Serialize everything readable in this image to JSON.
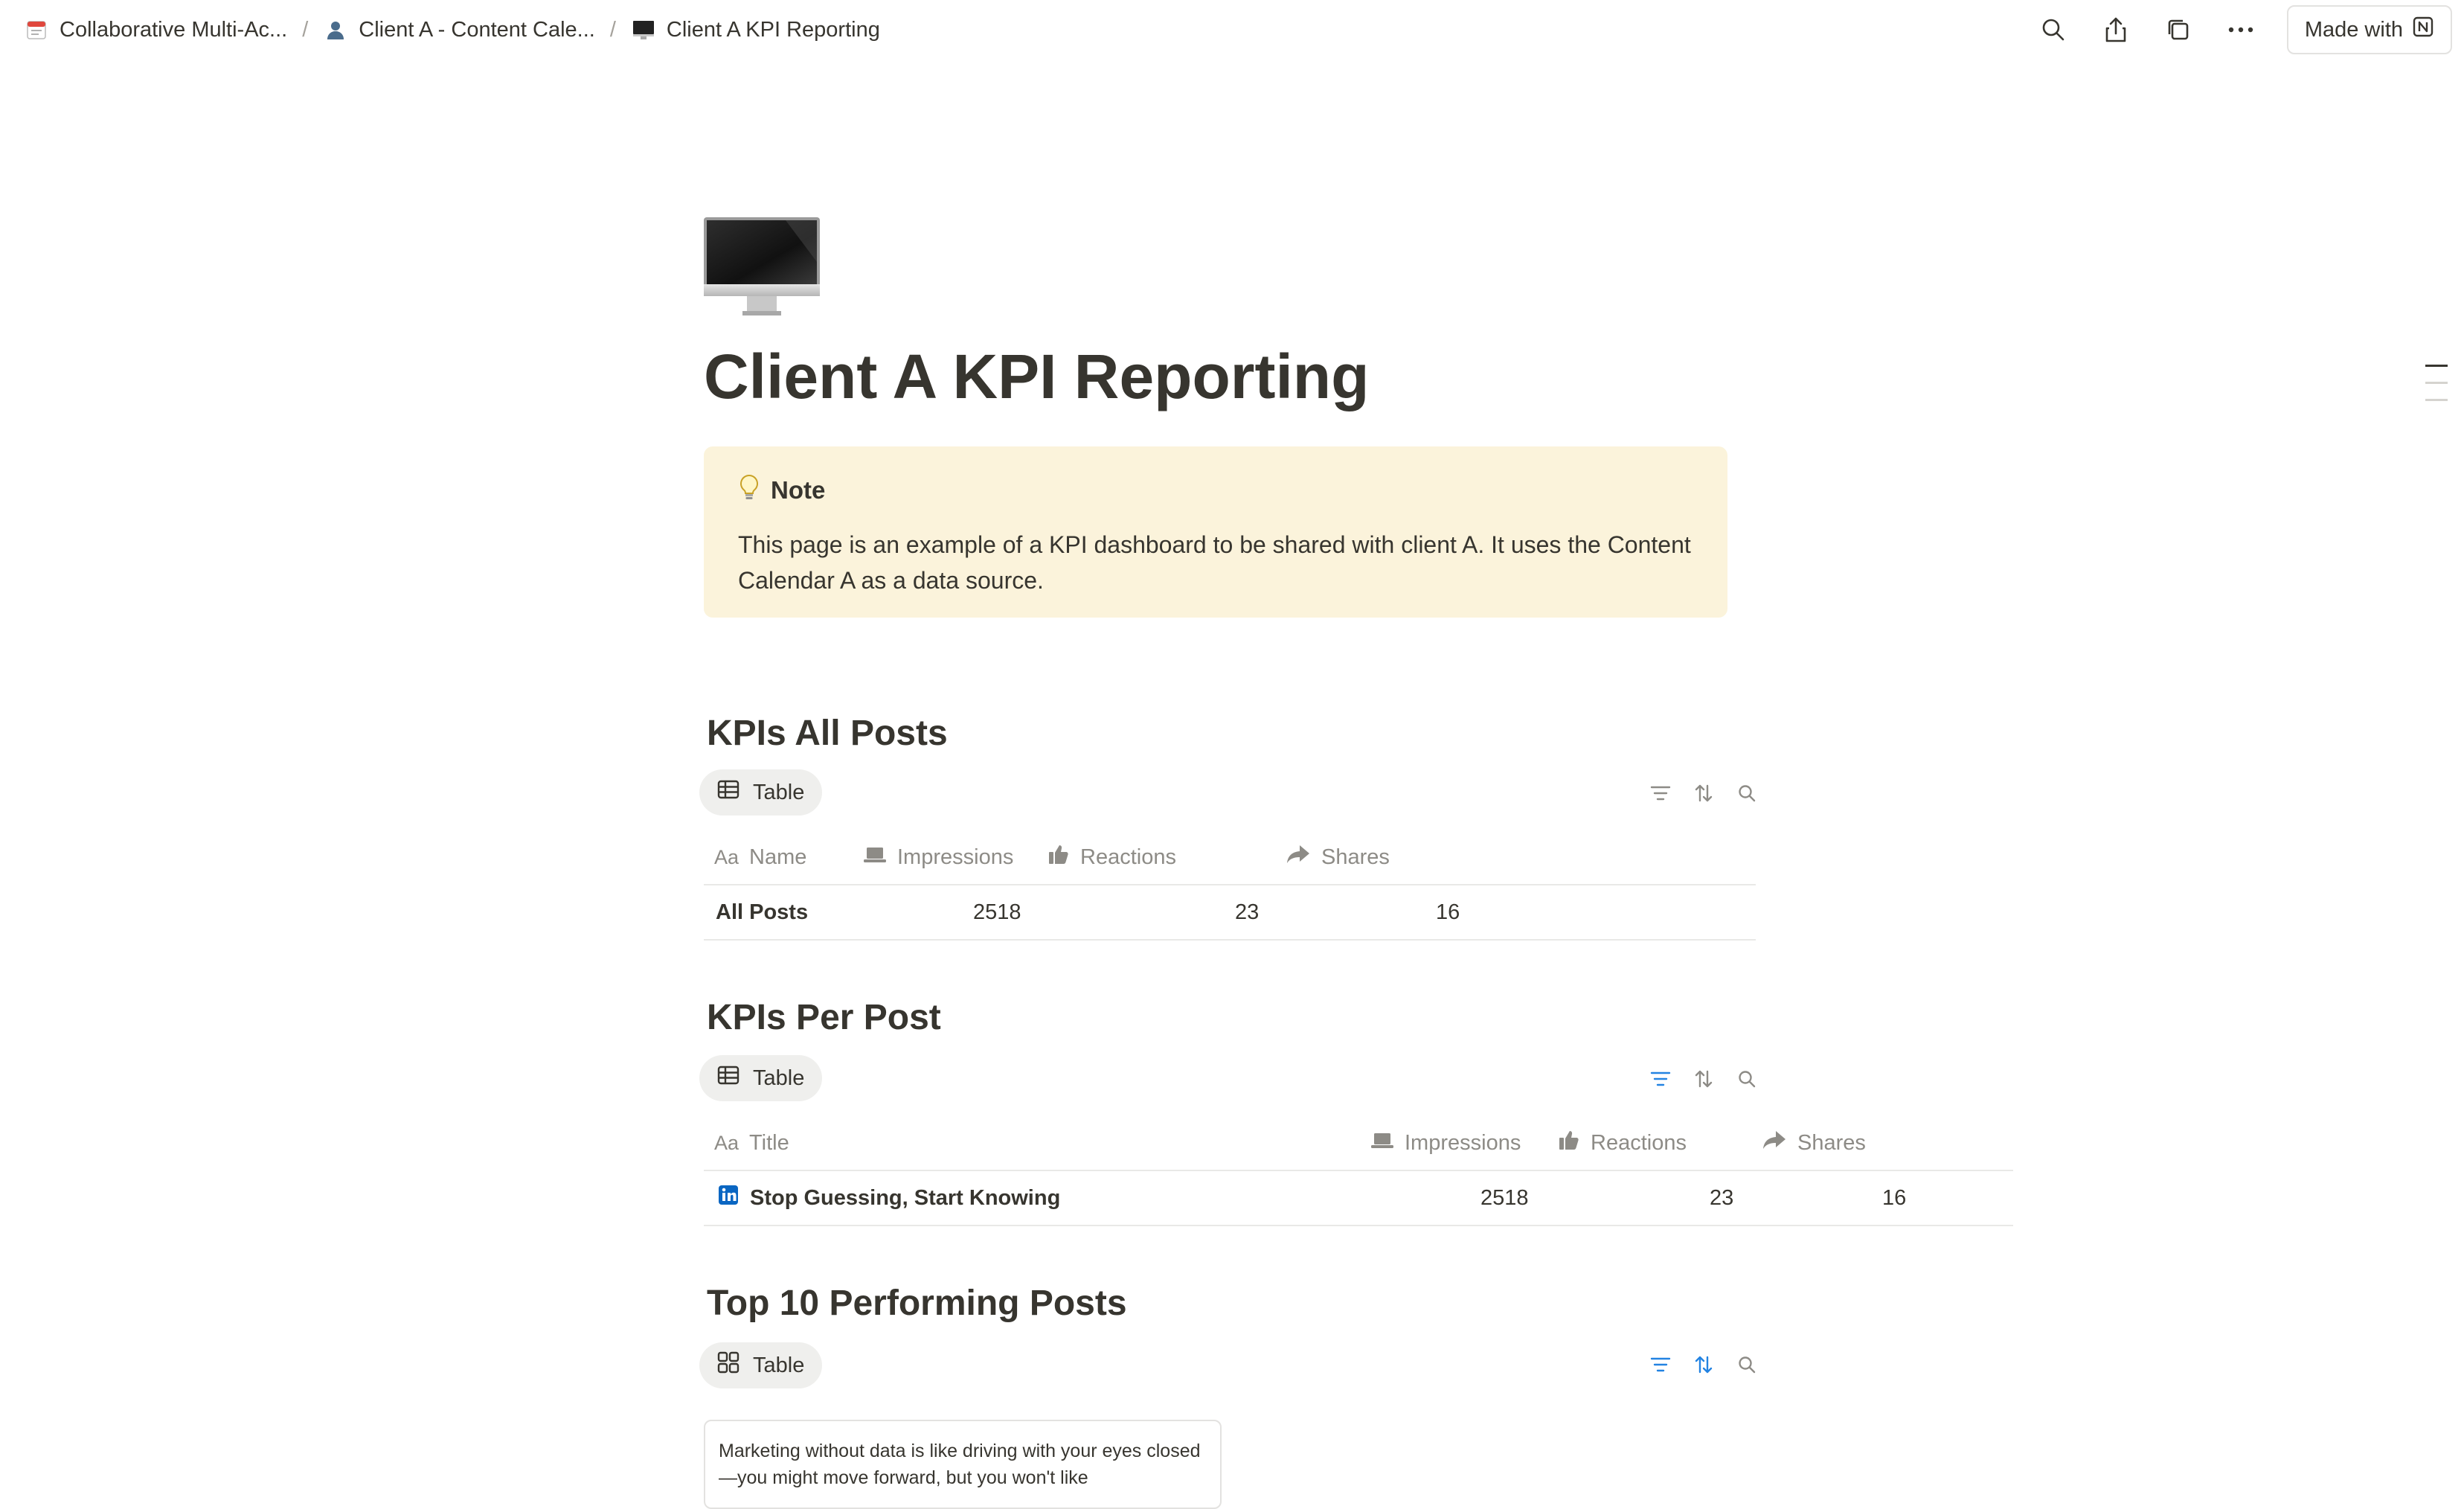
{
  "breadcrumbs": [
    {
      "label": "Collaborative Multi-Ac...",
      "icon": "calendar-icon"
    },
    {
      "label": "Client A - Content Cale...",
      "icon": "person-icon"
    },
    {
      "label": "Client A KPI Reporting",
      "icon": "monitor-icon"
    }
  ],
  "topbar": {
    "made_with_label": "Made with",
    "icons": [
      "search-icon",
      "share-icon",
      "duplicate-icon",
      "more-icon",
      "notion-logo-icon"
    ]
  },
  "page": {
    "title": "Client A KPI Reporting",
    "icon": "desktop-computer-icon"
  },
  "callout": {
    "icon": "lightbulb-icon",
    "title": "Note",
    "body": "This page is an example of a KPI dashboard to be shared with client A. It uses the Content Calendar A as a data source."
  },
  "sections": [
    {
      "title": "KPIs All Posts",
      "view_label": "Table",
      "view_icon": "table-icon",
      "columns": [
        {
          "label": "Name",
          "icon": "text-property-icon"
        },
        {
          "label": "Impressions",
          "icon": "laptop-icon"
        },
        {
          "label": "Reactions",
          "icon": "thumbs-up-icon"
        },
        {
          "label": "Shares",
          "icon": "share-arrow-icon"
        }
      ],
      "rows": [
        {
          "name": "All Posts",
          "impressions": "2518",
          "reactions": "23",
          "shares": "16"
        }
      ]
    },
    {
      "title": "KPIs Per Post",
      "view_label": "Table",
      "view_icon": "table-icon",
      "columns": [
        {
          "label": "Title",
          "icon": "text-property-icon"
        },
        {
          "label": "Impressions",
          "icon": "laptop-icon"
        },
        {
          "label": "Reactions",
          "icon": "thumbs-up-icon"
        },
        {
          "label": "Shares",
          "icon": "share-arrow-icon"
        }
      ],
      "rows": [
        {
          "title": "Stop Guessing, Start Knowing",
          "icon": "linkedin-icon",
          "impressions": "2518",
          "reactions": "23",
          "shares": "16"
        }
      ]
    },
    {
      "title": "Top 10 Performing Posts",
      "view_label": "Table",
      "view_icon": "gallery-icon",
      "card_text": "Marketing without data is like driving with your eyes closed—you might move forward, but you won't like"
    }
  ],
  "colors": {
    "text": "#37352f",
    "muted": "#8d8b86",
    "callout_bg": "#fbf3db",
    "active_tool": "#2383e2",
    "linkedin": "#0a66c2"
  }
}
